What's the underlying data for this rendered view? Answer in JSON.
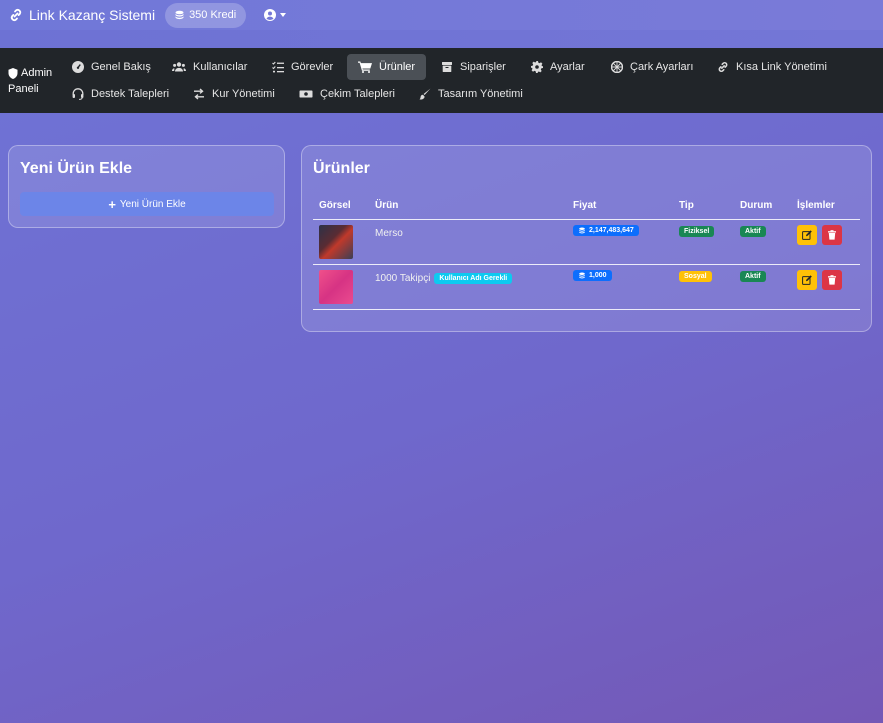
{
  "topbar": {
    "brand": "Link Kazanç Sistemi",
    "credit": "350 Kredi"
  },
  "adminnav": {
    "brand_line1": "Admin",
    "brand_line2": "Paneli",
    "items": [
      {
        "label": "Genel Bakış",
        "icon": "gauge-icon"
      },
      {
        "label": "Kullanıcılar",
        "icon": "users-icon"
      },
      {
        "label": "Görevler",
        "icon": "list-check-icon"
      },
      {
        "label": "Ürünler",
        "icon": "cart-icon",
        "active": true
      },
      {
        "label": "Siparişler",
        "icon": "box-icon"
      },
      {
        "label": "Ayarlar",
        "icon": "gear-icon"
      },
      {
        "label": "Çark Ayarları",
        "icon": "wheel-icon"
      },
      {
        "label": "Kısa Link Yönetimi",
        "icon": "link-icon"
      },
      {
        "label": "Destek Talepleri",
        "icon": "headset-icon"
      },
      {
        "label": "Kur Yönetimi",
        "icon": "exchange-icon"
      },
      {
        "label": "Çekim Talepleri",
        "icon": "money-icon"
      },
      {
        "label": "Tasarım Yönetimi",
        "icon": "brush-icon"
      }
    ]
  },
  "add_card": {
    "title": "Yeni Ürün Ekle",
    "button": "Yeni Ürün Ekle"
  },
  "products_card": {
    "title": "Ürünler",
    "columns": [
      "Görsel",
      "Ürün",
      "Fiyat",
      "Tip",
      "Durum",
      "İşlemler"
    ],
    "rows": [
      {
        "name": "Merso",
        "tag": "",
        "price": "2,147,483,647",
        "type": "Fiziksel",
        "status": "Aktif"
      },
      {
        "name": "1000 Takipçi",
        "tag": "Kullanıcı Adı Gerekli",
        "price": "1,000",
        "type": "Sosyal",
        "status": "Aktif"
      }
    ]
  },
  "colors": {
    "primary": "#0d6efd",
    "success": "#198754",
    "warning": "#ffc107",
    "info": "#0dcaf0",
    "danger": "#dc3545",
    "navbar": "#212529"
  }
}
